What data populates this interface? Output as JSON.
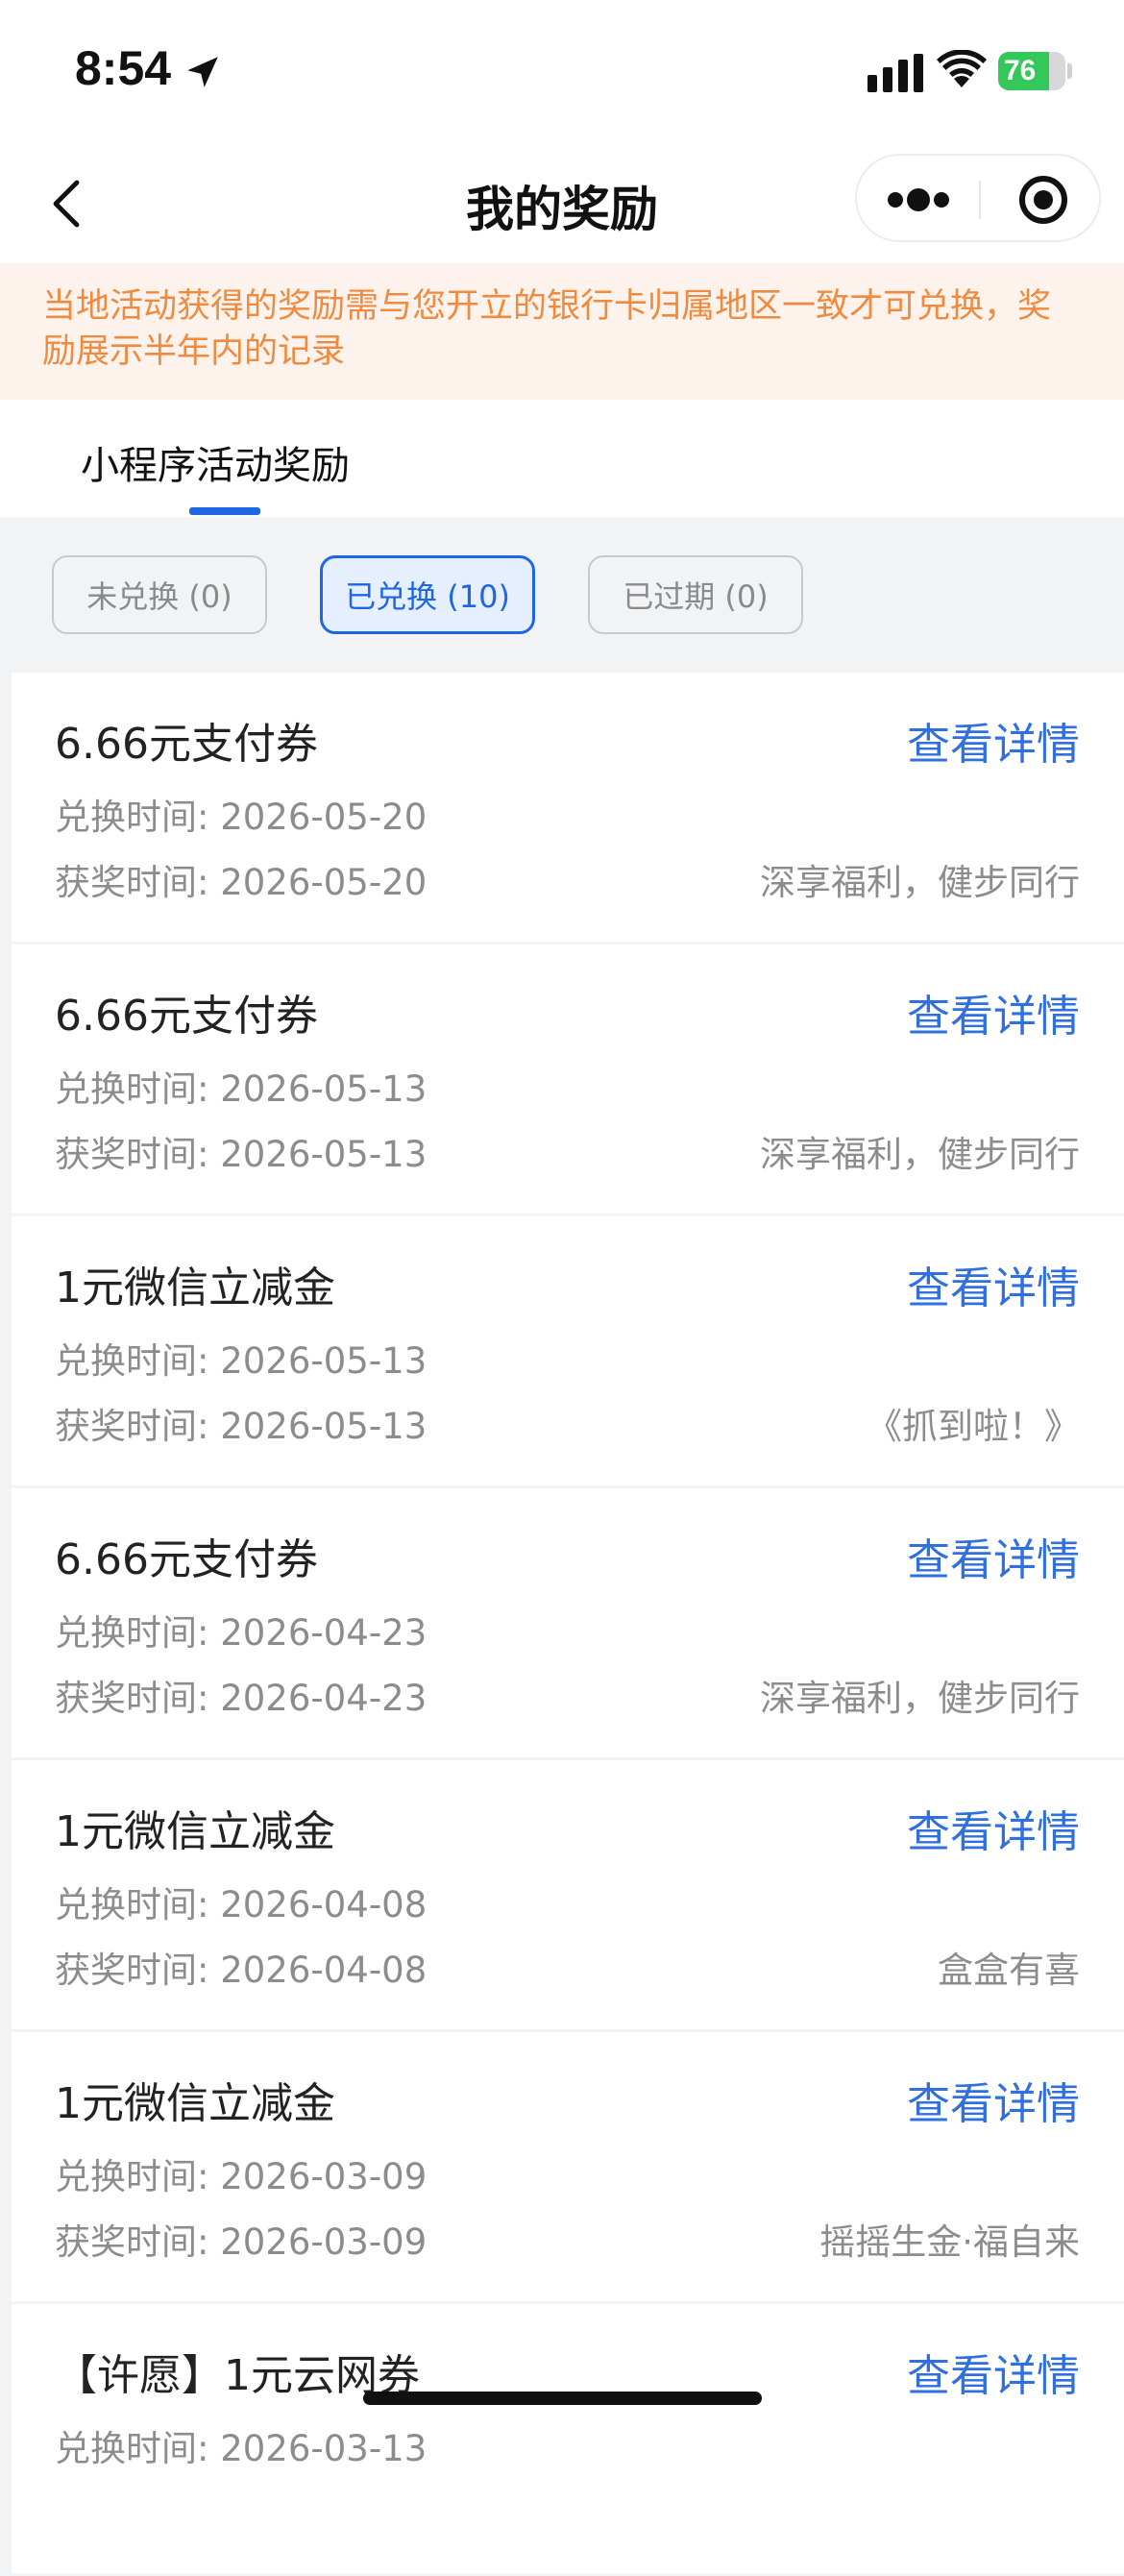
{
  "status_bar": {
    "time": "8:54",
    "battery_text": "76",
    "battery_level": 0.76,
    "battery_color": "#34c759"
  },
  "nav": {
    "title": "我的奖励",
    "back_icon": "chevron-left-icon",
    "more_icon": "more-dots-icon",
    "close_icon": "target-circle-icon"
  },
  "notice": {
    "text": "当地活动获得的奖励需与您开立的银行卡归属地区一致才可兑换，奖励展示半年内的记录",
    "color": "#f08a3e"
  },
  "tabs": [
    {
      "label": "小程序活动奖励",
      "active": true
    }
  ],
  "filters": [
    {
      "label": "未兑换 (0)",
      "active": false
    },
    {
      "label": "已兑换 (10)",
      "active": true
    },
    {
      "label": "已过期 (0)",
      "active": false
    }
  ],
  "accent_color": "#1f66e5",
  "rewards": [
    {
      "title": "6.66元支付券",
      "link": "查看详情",
      "redeem": "兑换时间: 2026-05-20",
      "award": "获奖时间: 2026-05-20",
      "source": "深享福利，健步同行"
    },
    {
      "title": "6.66元支付券",
      "link": "查看详情",
      "redeem": "兑换时间: 2026-05-13",
      "award": "获奖时间: 2026-05-13",
      "source": "深享福利，健步同行"
    },
    {
      "title": "1元微信立减金",
      "link": "查看详情",
      "redeem": "兑换时间: 2026-05-13",
      "award": "获奖时间: 2026-05-13",
      "source": "《抓到啦！》"
    },
    {
      "title": "6.66元支付券",
      "link": "查看详情",
      "redeem": "兑换时间: 2026-04-23",
      "award": "获奖时间: 2026-04-23",
      "source": "深享福利，健步同行"
    },
    {
      "title": "1元微信立减金",
      "link": "查看详情",
      "redeem": "兑换时间: 2026-04-08",
      "award": "获奖时间: 2026-04-08",
      "source": "盒盒有喜"
    },
    {
      "title": "1元微信立减金",
      "link": "查看详情",
      "redeem": "兑换时间: 2026-03-09",
      "award": "获奖时间: 2026-03-09",
      "source": "摇摇生金·福自来"
    },
    {
      "title": "【许愿】1元云网券",
      "link": "查看详情",
      "redeem": "兑换时间: 2026-03-13",
      "award": "",
      "source": ""
    }
  ]
}
